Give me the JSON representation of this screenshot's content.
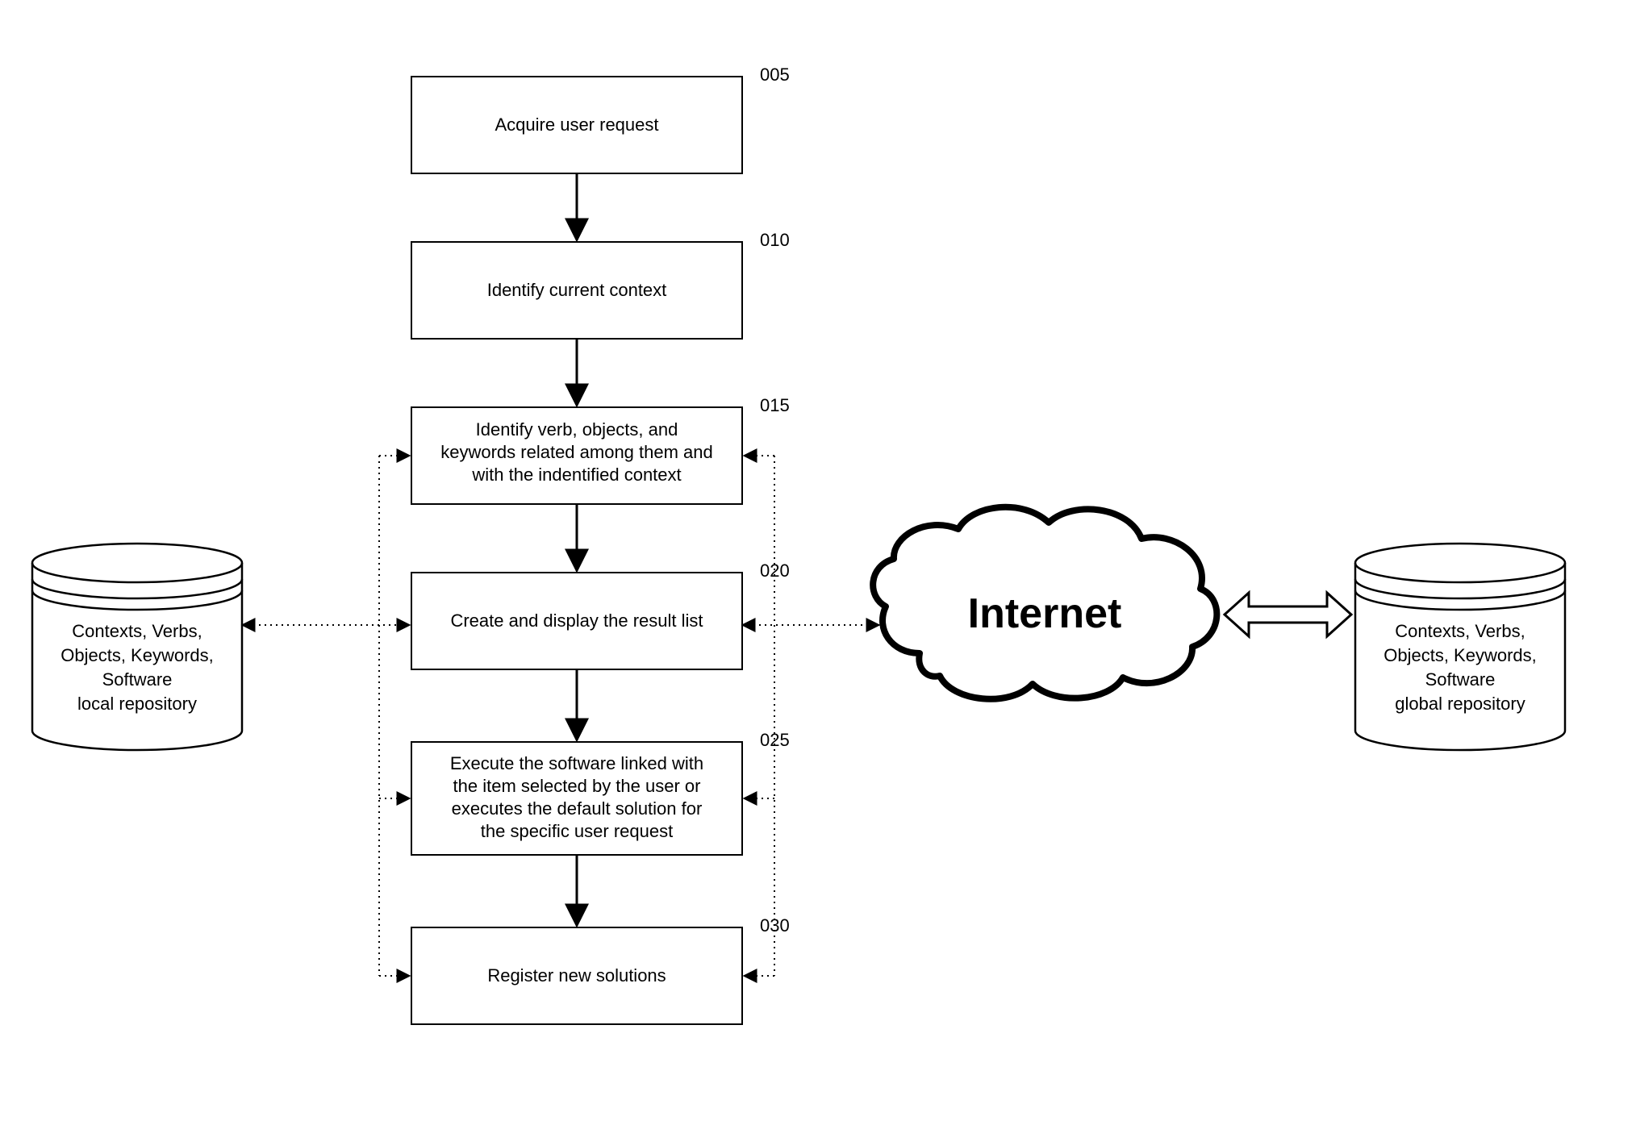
{
  "refs": {
    "b005": "005",
    "b010": "010",
    "b015": "015",
    "b020": "020",
    "b025": "025",
    "b030": "030"
  },
  "boxes": {
    "b005": [
      "Acquire user request"
    ],
    "b010": [
      "Identify current context"
    ],
    "b015": [
      "Identify verb, objects, and",
      "keywords related among them and",
      "with the indentified context"
    ],
    "b020": [
      "Create and display the result list"
    ],
    "b025": [
      "Execute the software linked with",
      "the item selected by the user or",
      "executes the default solution for",
      "the specific user request"
    ],
    "b030": [
      "Register new solutions"
    ]
  },
  "left_db": [
    "Contexts, Verbs,",
    "Objects, Keywords,",
    "Software",
    "local repository"
  ],
  "right_db": [
    "Contexts, Verbs,",
    "Objects, Keywords,",
    "Software",
    "global repository"
  ],
  "cloud": "Internet"
}
